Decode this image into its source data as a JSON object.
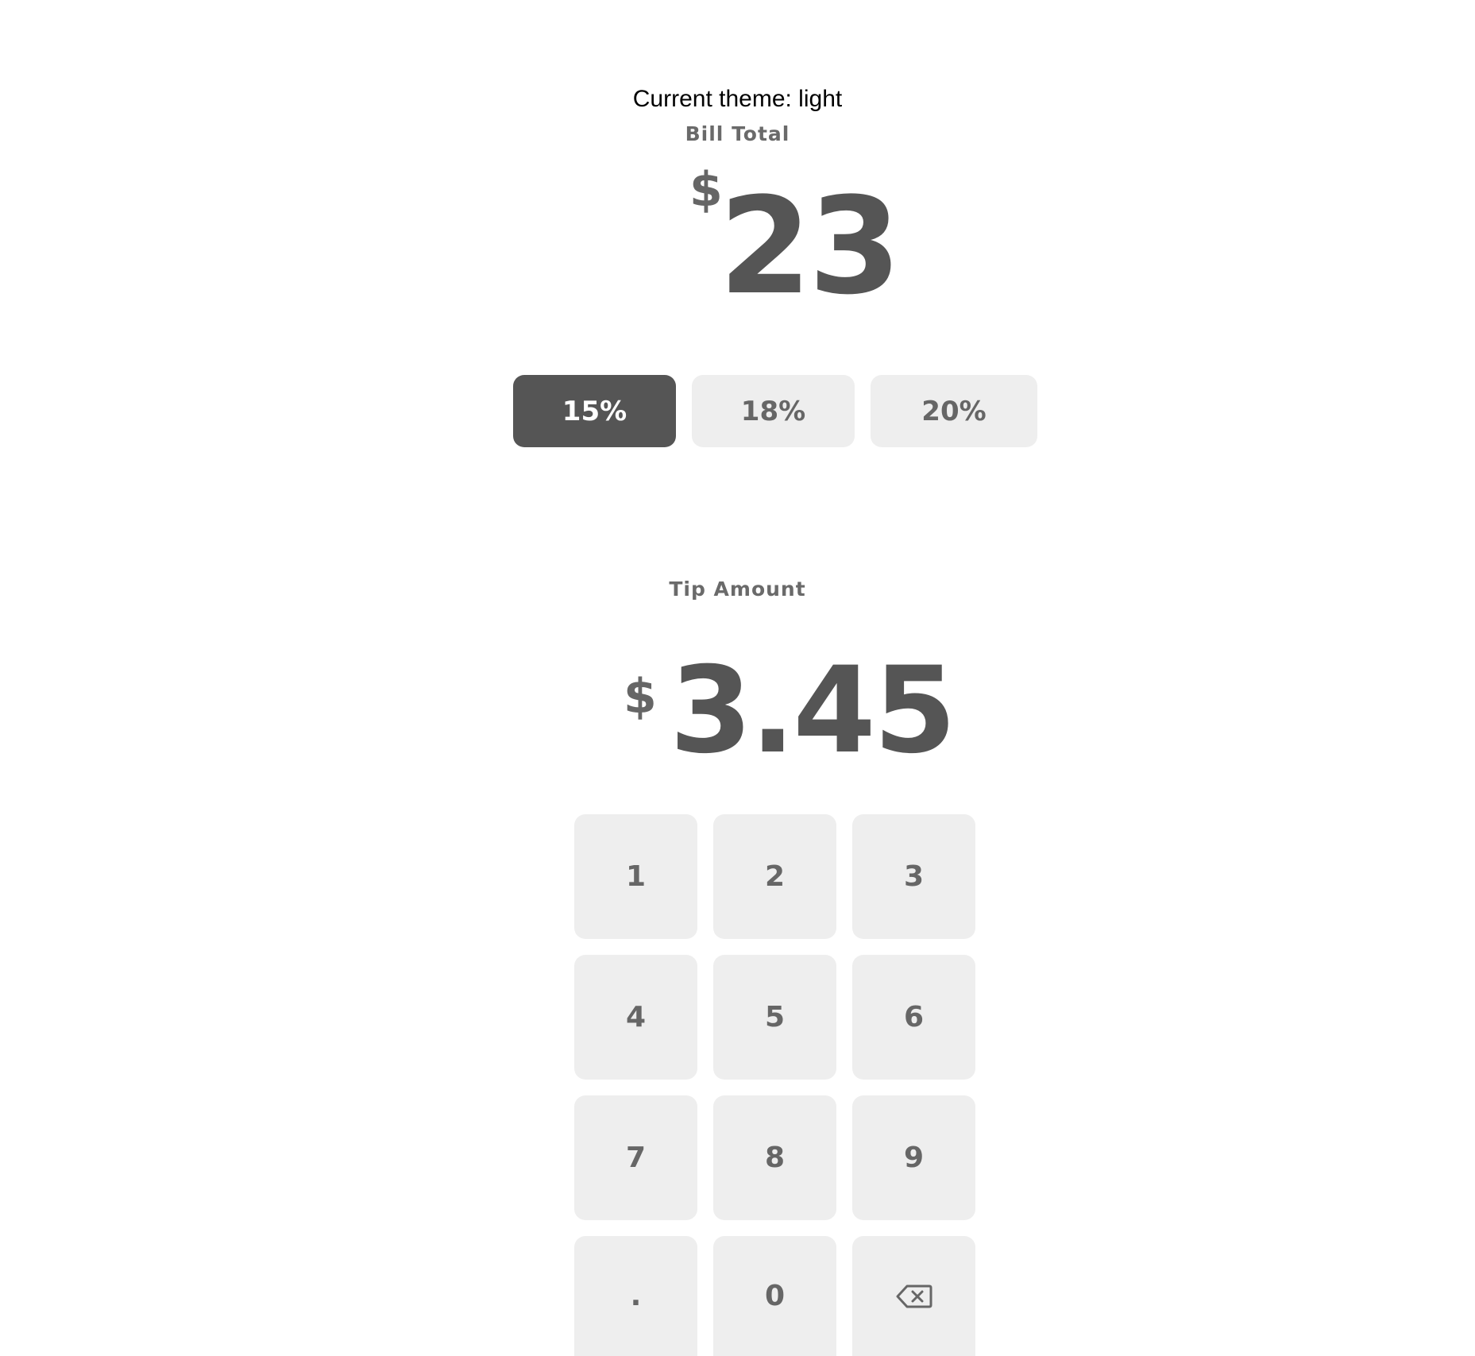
{
  "theme_text": "Current theme: light",
  "bill": {
    "label": "Bill Total",
    "currency": "$",
    "value": "23"
  },
  "tip_options": [
    {
      "label": "15%",
      "active": true
    },
    {
      "label": "18%",
      "active": false
    },
    {
      "label": "20%",
      "active": false
    }
  ],
  "tip": {
    "label": "Tip Amount",
    "currency": "$",
    "value": "3.45"
  },
  "keypad": {
    "keys": [
      "1",
      "2",
      "3",
      "4",
      "5",
      "6",
      "7",
      "8",
      "9",
      ".",
      "0"
    ],
    "backspace_icon": "backspace-icon"
  },
  "colors": {
    "accent": "#555555",
    "button_bg": "#eeeeee",
    "text": "#666666",
    "background": "#ffffff"
  }
}
